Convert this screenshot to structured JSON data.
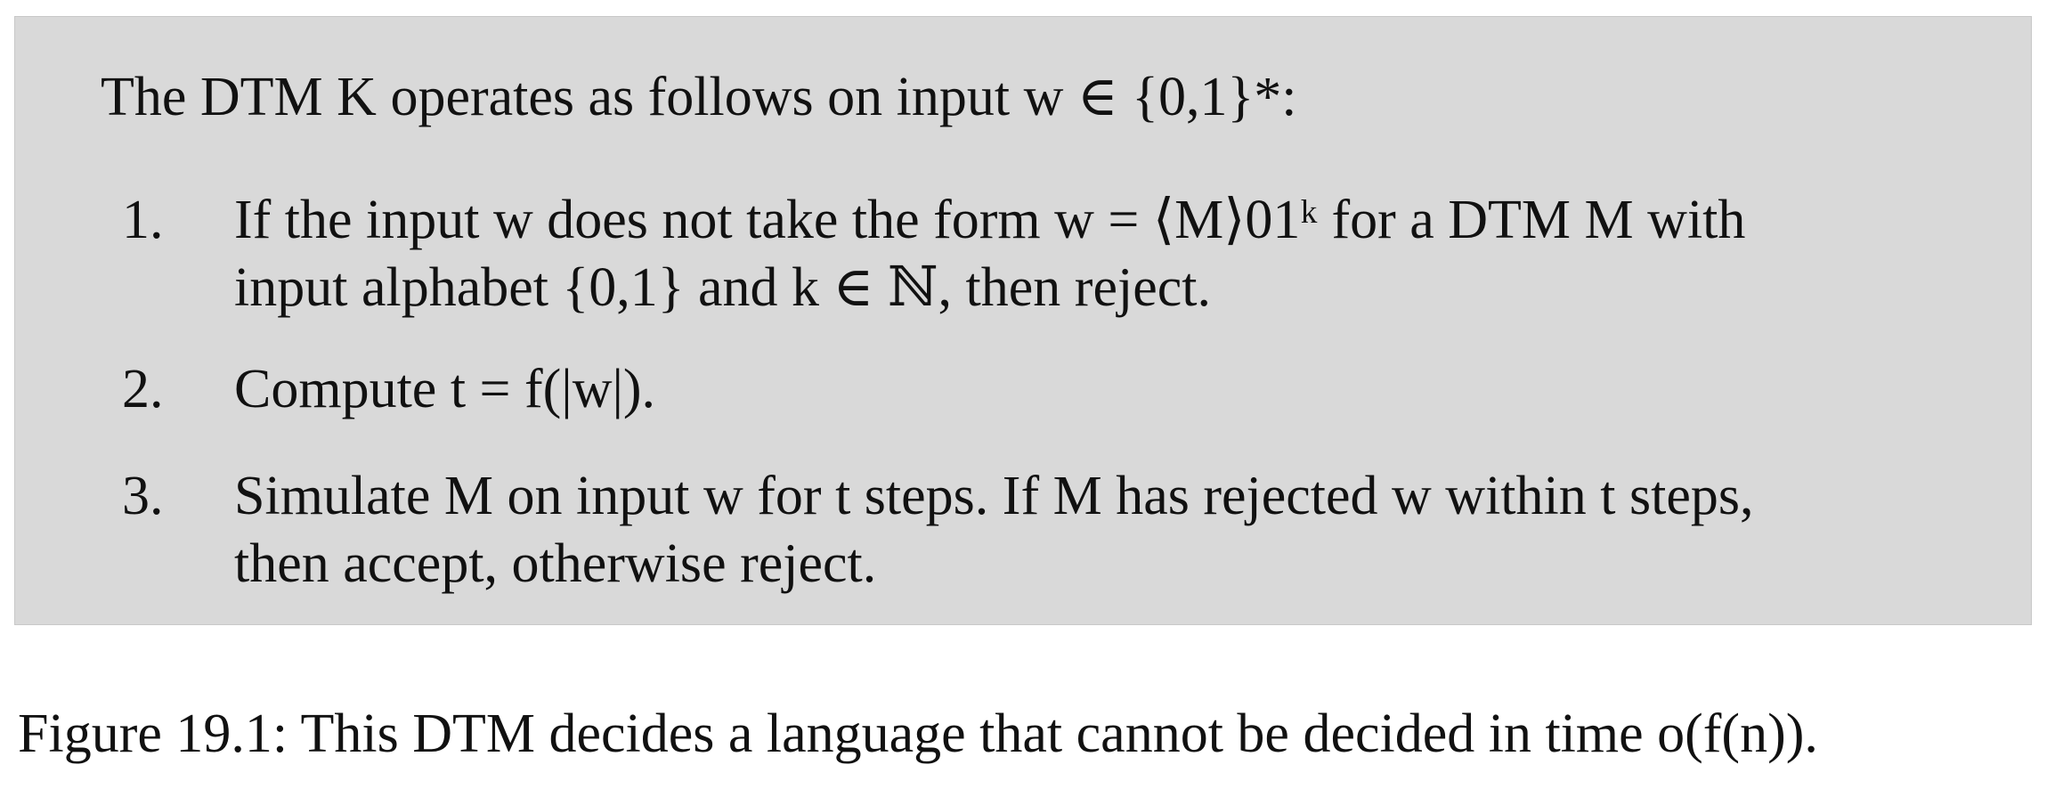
{
  "box": {
    "intro": "The DTM K operates as follows on input w ∈ {0,1}*:",
    "items": [
      {
        "number": "1.",
        "lines": [
          "If the input w does not take the form w = ⟨M⟩01ᵏ for a DTM M with",
          "input alphabet {0,1} and k ∈ ℕ, then reject."
        ]
      },
      {
        "number": "2.",
        "lines": [
          "Compute t = f(|w|)."
        ]
      },
      {
        "number": "3.",
        "lines": [
          "Simulate M on input w for t steps. If M has rejected w within t steps,",
          "then accept, otherwise reject."
        ]
      }
    ]
  },
  "caption": "Figure 19.1: This DTM decides a language that cannot be decided in time o(f(n)).",
  "colors": {
    "box_background": "#d9d9d9",
    "text": "#111111"
  }
}
